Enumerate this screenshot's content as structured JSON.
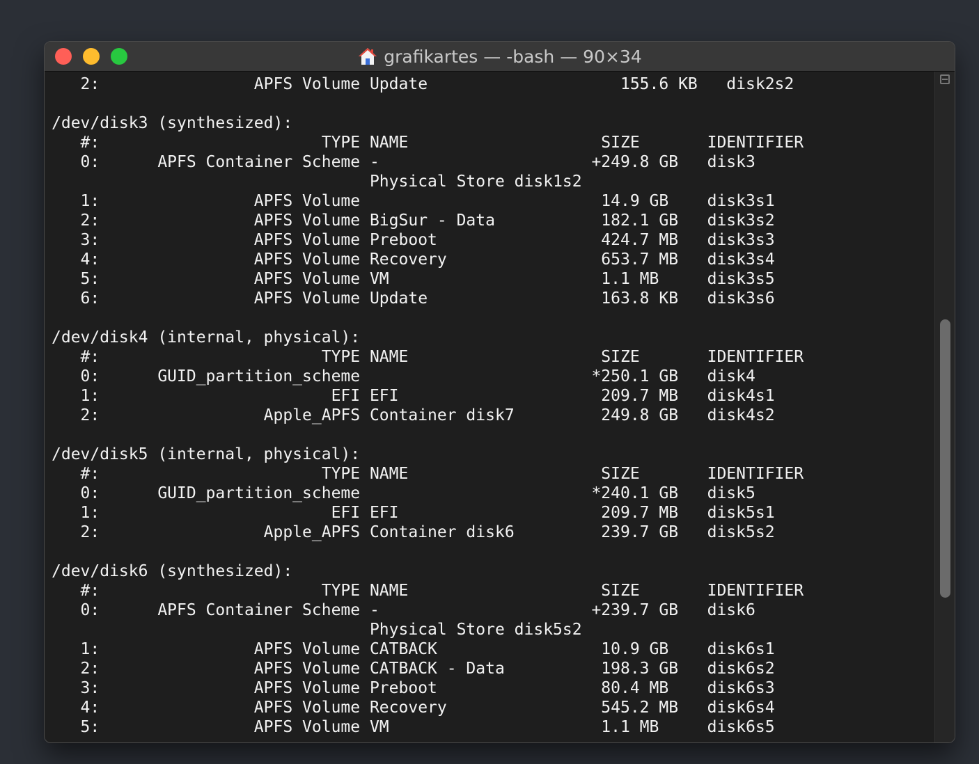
{
  "window": {
    "title": "grafikartes — -bash — 90×34",
    "title_icon": "home-folder-icon",
    "controls": {
      "close_color": "#ff5f57",
      "minimize_color": "#febc2e",
      "zoom_color": "#28c840"
    }
  },
  "terminal": {
    "lines": [
      "   2:                APFS Volume Update                    155.6 KB   disk2s2",
      "",
      "/dev/disk3 (synthesized):",
      "   #:                       TYPE NAME                    SIZE       IDENTIFIER",
      "   0:      APFS Container Scheme -                      +249.8 GB   disk3",
      "                                 Physical Store disk1s2",
      "   1:                APFS Volume                         14.9 GB    disk3s1",
      "   2:                APFS Volume BigSur - Data           182.1 GB   disk3s2",
      "   3:                APFS Volume Preboot                 424.7 MB   disk3s3",
      "   4:                APFS Volume Recovery                653.7 MB   disk3s4",
      "   5:                APFS Volume VM                      1.1 MB     disk3s5",
      "   6:                APFS Volume Update                  163.8 KB   disk3s6",
      "",
      "/dev/disk4 (internal, physical):",
      "   #:                       TYPE NAME                    SIZE       IDENTIFIER",
      "   0:      GUID_partition_scheme                        *250.1 GB   disk4",
      "   1:                        EFI EFI                     209.7 MB   disk4s1",
      "   2:                 Apple_APFS Container disk7         249.8 GB   disk4s2",
      "",
      "/dev/disk5 (internal, physical):",
      "   #:                       TYPE NAME                    SIZE       IDENTIFIER",
      "   0:      GUID_partition_scheme                        *240.1 GB   disk5",
      "   1:                        EFI EFI                     209.7 MB   disk5s1",
      "   2:                 Apple_APFS Container disk6         239.7 GB   disk5s2",
      "",
      "/dev/disk6 (synthesized):",
      "   #:                       TYPE NAME                    SIZE       IDENTIFIER",
      "   0:      APFS Container Scheme -                      +239.7 GB   disk6",
      "                                 Physical Store disk5s2",
      "   1:                APFS Volume CATBACK                 10.9 GB    disk6s1",
      "   2:                APFS Volume CATBACK - Data          198.3 GB   disk6s2",
      "   3:                APFS Volume Preboot                 80.4 MB    disk6s3",
      "   4:                APFS Volume Recovery                545.2 MB   disk6s4",
      "   5:                APFS Volume VM                      1.1 MB     disk6s5"
    ]
  },
  "scrollbar": {
    "position_fraction": 0.42,
    "visible_fraction": 0.42
  }
}
